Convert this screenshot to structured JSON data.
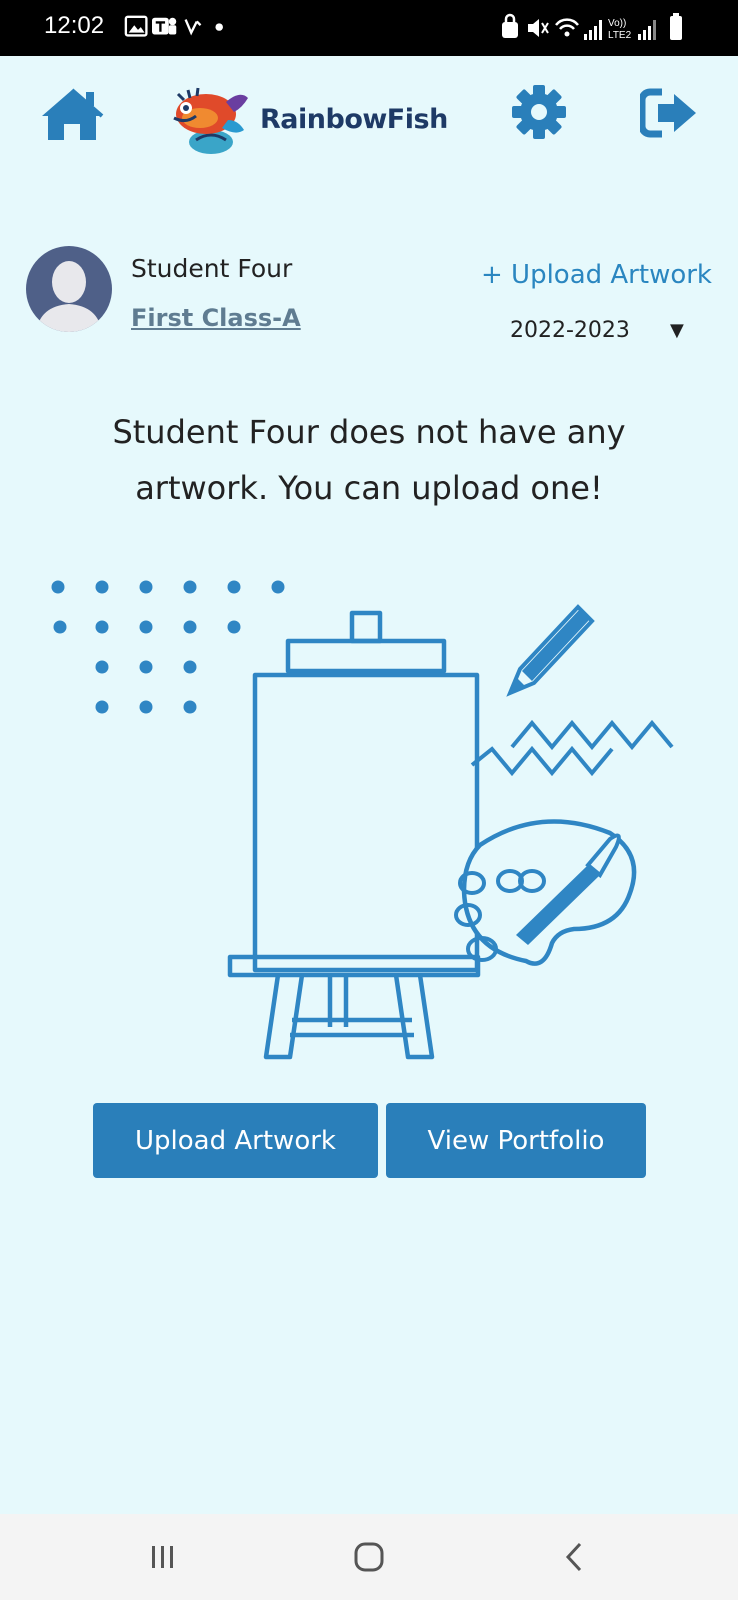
{
  "status_bar": {
    "time": "12:02",
    "left_icons": [
      "gallery-icon",
      "teams-icon",
      "missed-call-icon",
      "dot-icon"
    ],
    "right_icons": [
      "lock-icon",
      "mute-icon",
      "wifi-icon",
      "signal-icon",
      "volte-lte2-icon",
      "signal-icon",
      "battery-icon"
    ],
    "volte_text": "Vo))",
    "lte_text": "LTE2"
  },
  "header": {
    "home_icon": "home-icon",
    "logo_text": "RainbowFish",
    "settings_icon": "gear-icon",
    "logout_icon": "sign-out-icon"
  },
  "student": {
    "name": "Student Four",
    "class_name": "First Class-A",
    "upload_link": "+ Upload Artwork",
    "year": "2022-2023",
    "year_caret": "▼"
  },
  "empty_state": {
    "line1": "Student Four does not have any",
    "line2": "artwork. You can upload one!"
  },
  "actions": {
    "upload_label": "Upload Artwork",
    "portfolio_label": "View Portfolio"
  },
  "colors": {
    "background": "#e6f9fc",
    "accent": "#2a7fba",
    "illustration": "#2f86c4",
    "link": "#5f7c91"
  },
  "system_nav": {
    "icons": [
      "recents-icon",
      "home-circle-icon",
      "back-icon"
    ]
  }
}
